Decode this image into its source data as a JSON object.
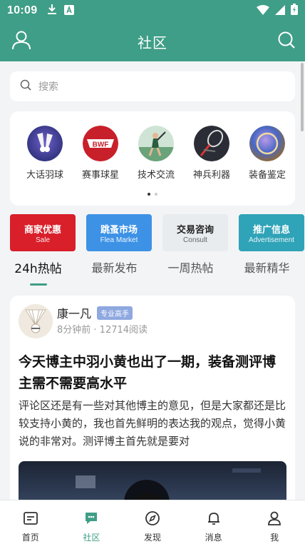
{
  "status_bar": {
    "time": "10:09"
  },
  "header": {
    "title": "社区"
  },
  "search": {
    "placeholder": "搜索"
  },
  "categories": [
    {
      "label": "大话羽球",
      "icon": "shuttlecock-icon"
    },
    {
      "label": "赛事球星",
      "icon": "bwf-logo-icon"
    },
    {
      "label": "技术交流",
      "icon": "player-smash-icon"
    },
    {
      "label": "神兵利器",
      "icon": "racket-icon"
    },
    {
      "label": "装备鉴定",
      "icon": "magnifier-lens-icon"
    }
  ],
  "banners": [
    {
      "title": "商家优惠",
      "subtitle": "Sale",
      "color": "#d81f2a"
    },
    {
      "title": "跳蚤市场",
      "subtitle": "Flea Market",
      "color": "#3d92e6"
    },
    {
      "title": "交易咨询",
      "subtitle": "Consult",
      "color": "#e8ecef"
    },
    {
      "title": "推广信息",
      "subtitle": "Advertisement",
      "color": "#2fa3b8"
    }
  ],
  "tabs": [
    "24h热帖",
    "最新发布",
    "一周热帖",
    "最新精华"
  ],
  "post": {
    "author": "康一凡",
    "badge": "专业高手",
    "meta": "8分钟前 · 12714阅读",
    "title": "今天博主中羽小黄也出了一期，装备测评博主需不需要高水平",
    "body": "评论区还是有一些对其他博主的意见，但是大家都还是比较支持小黄的，我也首先鲜明的表达我的观点，觉得小黄说的非常对。测评博主首先就是要对"
  },
  "bottom_nav": [
    {
      "label": "首页",
      "icon": "home-icon"
    },
    {
      "label": "社区",
      "icon": "community-chat-icon"
    },
    {
      "label": "发现",
      "icon": "compass-icon"
    },
    {
      "label": "消息",
      "icon": "bell-icon"
    },
    {
      "label": "我",
      "icon": "person-icon"
    }
  ],
  "colors": {
    "accent": "#3f9e87",
    "background": "#f3f4f6"
  }
}
